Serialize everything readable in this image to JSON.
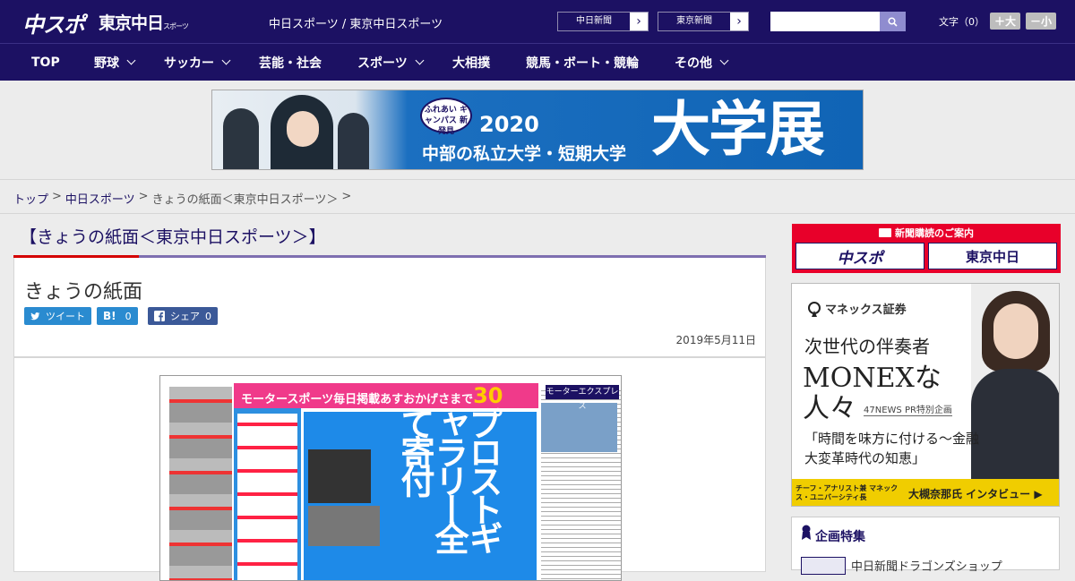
{
  "header": {
    "logo_chuspo": "中スポ",
    "logo_tokyo": "東京中日",
    "logo_tokyo_small": "スポーツ",
    "site_names": "中日スポーツ / 東京中日スポーツ",
    "link_chunichi": "中日新聞",
    "link_tokyo": "東京新聞",
    "search_placeholder": "",
    "font_label": "文字（0）",
    "font_larger": "＋大",
    "font_smaller": "－小"
  },
  "nav": {
    "items": [
      {
        "label": "TOP",
        "has_menu": false
      },
      {
        "label": "野球",
        "has_menu": true
      },
      {
        "label": "サッカー",
        "has_menu": true
      },
      {
        "label": "芸能・社会",
        "has_menu": false
      },
      {
        "label": "スポーツ",
        "has_menu": true
      },
      {
        "label": "大相撲",
        "has_menu": false
      },
      {
        "label": "競馬・ボート・競輪",
        "has_menu": false
      },
      {
        "label": "その他",
        "has_menu": true
      }
    ]
  },
  "banner": {
    "badge": "ふれあい キャンパス 新発見",
    "year": "2020",
    "subtitle": "中部の私立大学・短期大学",
    "headline": "大学展"
  },
  "breadcrumb": {
    "home": "トップ",
    "sep": ">",
    "section": "中日スポーツ",
    "current": "きょうの紙面＜東京中日スポーツ＞",
    "trail": ">"
  },
  "article": {
    "section_title": "【きょうの紙面＜東京中日スポーツ＞】",
    "title": "きょうの紙面",
    "tweet_label": "ツイート",
    "hatena_label": "B!",
    "hatena_count": "0",
    "fb_label": "シェア",
    "fb_count": "0",
    "date": "2019年5月11日"
  },
  "newspaper": {
    "headline": "モータースポーツ毎日掲載あすおかげさまで",
    "years": "30",
    "big_text": "プロストギャラリー全て寄付",
    "badge": "モーターエクスプレス"
  },
  "sidebar": {
    "subscribe_title": "新聞購読のご案内",
    "sub_chuspo": "中スポ",
    "sub_tokyo": "東京中日",
    "ad": {
      "brand": "マネックス証券",
      "line1": "次世代の伴奏者",
      "line2": "MONEXな",
      "line3": "人々",
      "tag": "47NEWS PR特別企画",
      "quote": "「時間を味方に付ける～金融大変革時代の知恵」",
      "role": "チーフ・アナリスト兼 マネックス・ユニバーシティ長",
      "name": "大槻奈那氏 インタビュー ▶"
    },
    "feature_title": "企画特集",
    "feature_item": "中日新聞ドラゴンズショップ"
  },
  "colors": {
    "brand_navy": "#1c1163",
    "accent_red": "#d40000",
    "share_blue": "#2a8bd0",
    "ad_yellow": "#f0cd00"
  }
}
